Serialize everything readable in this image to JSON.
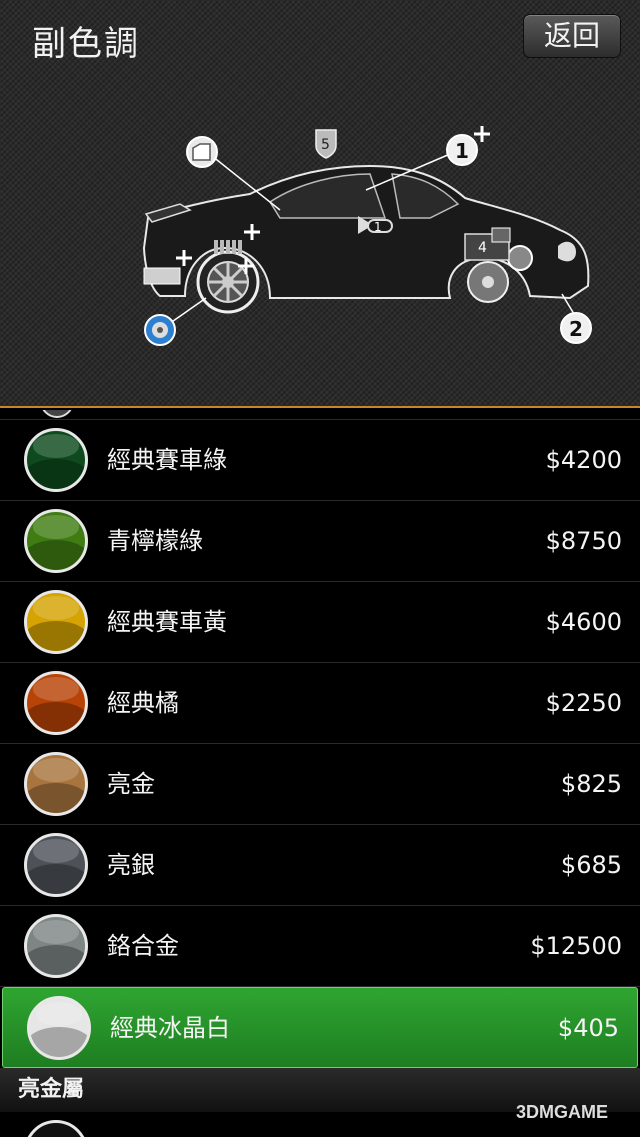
{
  "header": {
    "title": "副色調",
    "back_label": "返回",
    "markers": {
      "upgrade_level": "5",
      "hood_number": "1",
      "front_number": "2",
      "engine_number": "4",
      "horn_number": "1"
    }
  },
  "list": {
    "items": [
      {
        "name": "經典賽車綠",
        "price": "$4200",
        "color": "#0e4a1e",
        "selected": false
      },
      {
        "name": "青檸檬綠",
        "price": "$8750",
        "color": "#3f7d12",
        "selected": false
      },
      {
        "name": "經典賽車黃",
        "price": "$4600",
        "color": "#d5a302",
        "selected": false
      },
      {
        "name": "經典橘",
        "price": "$2250",
        "color": "#b84306",
        "selected": false
      },
      {
        "name": "亮金",
        "price": "$825",
        "color": "#a8753e",
        "selected": false
      },
      {
        "name": "亮銀",
        "price": "$685",
        "color": "#4d5158",
        "selected": false
      },
      {
        "name": "鉻合金",
        "price": "$12500",
        "color": "#7d8684",
        "selected": false
      },
      {
        "name": "經典冰晶白",
        "price": "$405",
        "color": "#e6e6e6",
        "selected": true
      }
    ],
    "section_header": "亮金屬"
  },
  "watermark": "3DMGAME"
}
